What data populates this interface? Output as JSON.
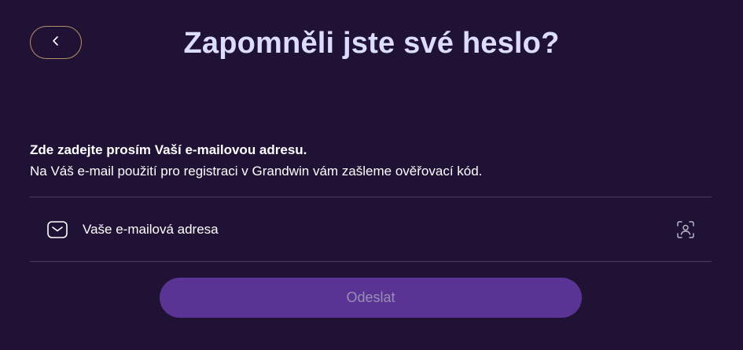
{
  "header": {
    "title": "Zapomněli jste své heslo?"
  },
  "instructions": {
    "line1": "Zde zadejte prosím Vaší e-mailovou adresu.",
    "line2": "Na Váš e-mail použití pro registraci v Grandwin vám zašleme ověřovací kód."
  },
  "email_field": {
    "placeholder": "Vaše e-mailová adresa",
    "value": ""
  },
  "submit": {
    "label": "Odeslat"
  },
  "icons": {
    "back": "chevron-left-icon",
    "email": "envelope-icon",
    "face_id": "face-id-icon"
  },
  "colors": {
    "background": "#1f1235",
    "title": "#dcdcff",
    "back_border": "#b78d6a",
    "button_bg": "#5a3494",
    "button_text": "#9a8db5",
    "divider": "#4b3d66"
  }
}
